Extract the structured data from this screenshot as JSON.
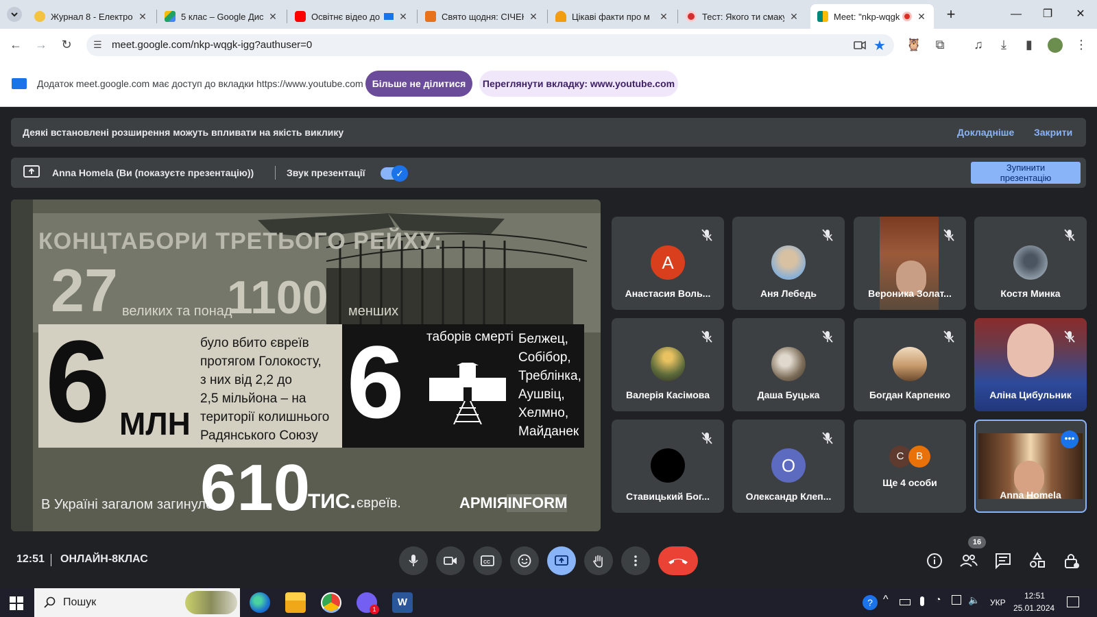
{
  "browser": {
    "tabs": [
      {
        "label": "Журнал 8 - Електро",
        "favicon_color": "#f5c342"
      },
      {
        "label": "5 клас – Google Дис",
        "favicon_color": "#1ea362"
      },
      {
        "label": "Освітнє відео до",
        "favicon_color": "#ff0000"
      },
      {
        "label": "Свято щодня: СІЧЕН",
        "favicon_color": "#e8711c"
      },
      {
        "label": "Цікаві факти про м",
        "favicon_color": "#f29d0f"
      },
      {
        "label": "Тест: Якого ти смаку",
        "favicon_color": "#d32f2f"
      },
      {
        "label": "Meet: \"nkp-wqgk",
        "favicon_color": "#00897b"
      }
    ],
    "url": "meet.google.com/nkp-wqgk-igg?authuser=0",
    "icons": [
      "tab-search-icon",
      "back-icon",
      "forward-icon",
      "reload-icon",
      "site-info-icon",
      "camera-icon",
      "bookmark-star-icon",
      "extension-icon",
      "puzzle-icon",
      "media-icon",
      "download-icon",
      "sidebar-icon",
      "profile-avatar",
      "menu-icon",
      "new-tab-icon",
      "minimize-icon",
      "restore-icon",
      "close-icon"
    ]
  },
  "share_banner": {
    "text": "Додаток meet.google.com має доступ до вкладки https://www.youtube.com",
    "stop_sharing": "Більше не ділитися",
    "view_tab": "Переглянути вкладку: www.youtube.com"
  },
  "meet": {
    "warning": {
      "message": "Деякі встановлені розширення можуть впливати на якість виклику",
      "learn_more": "Докладніше",
      "close": "Закрити"
    },
    "presenting": {
      "presenter": "Anna Homela (Ви (показуєте презентацію))",
      "sound_label": "Звук презентації",
      "sound_on": true,
      "stop_line1": "Зупинити",
      "stop_line2": "презентацію"
    },
    "slide": {
      "title": "КОНЦТАБОРИ ТРЕТЬОГО РЕЙХУ:",
      "num_27": "27",
      "great_and_over": "великих та понад",
      "num_1100": "1100",
      "smaller": "менших",
      "num_6": "6",
      "mln": "МЛН",
      "lines": [
        "було вбито євреїв",
        "протягом Голокосту,",
        "з них від 2,2 до",
        "2,5 мільйона – на",
        "території колишнього",
        "Радянського Союзу"
      ],
      "camps_num": "6",
      "camps_label": "таборів смерті",
      "camps": [
        "Белжец,",
        "Собібор,",
        "Треблінка,",
        "Аушвіц,",
        "Хелмно,",
        "Майданек"
      ],
      "ukraine_text": "В Україні загалом загинуло",
      "num_610": "610",
      "thousand": "ТИС.",
      "jews": "євреїв.",
      "logo": "АРМІЯINFORM"
    },
    "participants": [
      {
        "name": "Анастасия Воль...",
        "avatar": "А",
        "avatar_color": "#d93f1c",
        "muted": true
      },
      {
        "name": "Аня Лебедь",
        "avatar": "",
        "avatar_color": "#8ab0d6",
        "muted": true
      },
      {
        "name": "Вероника Золат...",
        "avatar": "",
        "avatar_color": "#7a4a33",
        "muted": true,
        "video": true
      },
      {
        "name": "Костя Минка",
        "avatar": "",
        "avatar_color": "#8d9aa5",
        "muted": true
      },
      {
        "name": "Валерія Касімова",
        "avatar": "",
        "avatar_color": "#5d6b3b",
        "muted": true
      },
      {
        "name": "Даша Буцька",
        "avatar": "",
        "avatar_color": "#7d6e5a",
        "muted": true
      },
      {
        "name": "Богдан Карпенко",
        "avatar": "",
        "avatar_color": "#c79a6b",
        "muted": true
      },
      {
        "name": "Аліна Цибульник",
        "avatar": "",
        "avatar_color": "#2d4a9b",
        "muted": true,
        "video": true
      },
      {
        "name": "Ставицький Бог...",
        "avatar": "",
        "avatar_color": "#000000",
        "muted": true
      },
      {
        "name": "Олександр Клеп...",
        "avatar": "О",
        "avatar_color": "#5c6bc0",
        "muted": true
      },
      {
        "name": "Ще 4 особи",
        "avatar_c": "C",
        "avatar_b": "B"
      },
      {
        "name": "Anna Homela",
        "video": true,
        "self": true
      }
    ],
    "meeting_time": "12:51",
    "meeting_name": "ОНЛАЙН-8КЛАС",
    "people_count": "16"
  },
  "taskbar": {
    "search_placeholder": "Пошук",
    "lang": "УКР",
    "time": "12:51",
    "date": "25.01.2024",
    "viber_badge": "1"
  }
}
